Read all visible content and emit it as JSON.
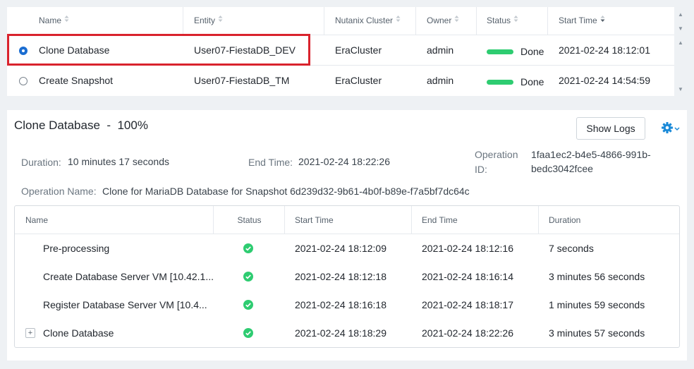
{
  "operations_table": {
    "columns": [
      "Name",
      "Entity",
      "Nutanix Cluster",
      "Owner",
      "Status",
      "Start Time"
    ],
    "rows": [
      {
        "name": "Clone Database",
        "entity": "User07-FiestaDB_DEV",
        "cluster": "EraCluster",
        "owner": "admin",
        "status": "Done",
        "start_time": "2021-02-24 18:12:01",
        "selected": true
      },
      {
        "name": "Create Snapshot",
        "entity": "User07-FiestaDB_TM",
        "cluster": "EraCluster",
        "owner": "admin",
        "status": "Done",
        "start_time": "2021-02-24 14:54:59",
        "selected": false
      }
    ]
  },
  "detail": {
    "title": "Clone Database  -  100%",
    "show_logs_label": "Show Logs",
    "duration_label": "Duration:",
    "duration_value": "10 minutes 17 seconds",
    "end_time_label": "End Time:",
    "end_time_value": "2021-02-24 18:22:26",
    "operation_id_label_1": "Operation",
    "operation_id_label_2": "ID:",
    "operation_id_value_1": "1faa1ec2-b4e5-4866-991b-",
    "operation_id_value_2": "bedc3042fcee",
    "operation_name_label": "Operation Name:",
    "operation_name_value": "Clone for MariaDB Database for Snapshot 6d239d32-9b61-4b0f-b89e-f7a5bf7dc64c"
  },
  "steps_table": {
    "columns": [
      "Name",
      "Status",
      "Start Time",
      "End Time",
      "Duration"
    ],
    "rows": [
      {
        "name": "Pre-processing",
        "start": "2021-02-24 18:12:09",
        "end": "2021-02-24 18:12:16",
        "duration": "7 seconds"
      },
      {
        "name": "Create Database Server VM [10.42.1...",
        "start": "2021-02-24 18:12:18",
        "end": "2021-02-24 18:16:14",
        "duration": "3 minutes 56 seconds"
      },
      {
        "name": "Register Database Server VM [10.4...",
        "start": "2021-02-24 18:16:18",
        "end": "2021-02-24 18:18:17",
        "duration": "1 minutes 59 seconds"
      },
      {
        "name": "Clone Database",
        "start": "2021-02-24 18:18:29",
        "end": "2021-02-24 18:22:26",
        "duration": "3 minutes 57 seconds",
        "expand": "+"
      }
    ]
  },
  "colors": {
    "status_done": "#2ecc71",
    "highlight": "#d9232d",
    "accent": "#1b6dd1"
  },
  "icons": [
    "sort-icon",
    "sort-desc-icon",
    "radio-icon",
    "gear-icon",
    "chevron-down-icon",
    "check-circle-icon",
    "expand-icon",
    "scroll-up-icon",
    "scroll-down-icon"
  ]
}
